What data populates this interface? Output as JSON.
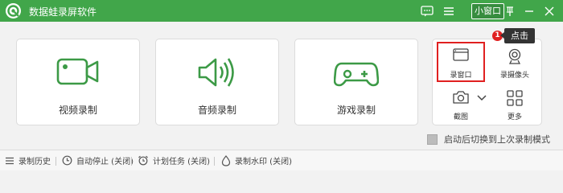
{
  "window": {
    "title": "数据蛙录屏软件",
    "mini_window_label": "小窗口",
    "accent_color": "#41a64a",
    "icons": [
      "logo-icon",
      "chat-icon",
      "menu-icon",
      "pin-icon",
      "minimize-icon",
      "close-icon"
    ]
  },
  "main_cards": [
    {
      "label": "视频录制",
      "icon": "video-camera-icon"
    },
    {
      "label": "音频录制",
      "icon": "speaker-icon"
    },
    {
      "label": "游戏录制",
      "icon": "gamepad-icon"
    }
  ],
  "side_panel": {
    "record_window": "录窗口",
    "record_webcam": "录摄像头",
    "screenshot": "截图",
    "more": "更多"
  },
  "annotation": {
    "badge_number": "1",
    "tooltip": "点击",
    "highlight_color": "#e02020"
  },
  "checkbox": {
    "label": "启动后切换到上次录制模式",
    "checked": false
  },
  "statusbar": {
    "history": "录制历史",
    "auto_stop": "自动停止 (关闭)",
    "schedule": "计划任务 (关闭)",
    "watermark": "录制水印 (关闭)"
  }
}
